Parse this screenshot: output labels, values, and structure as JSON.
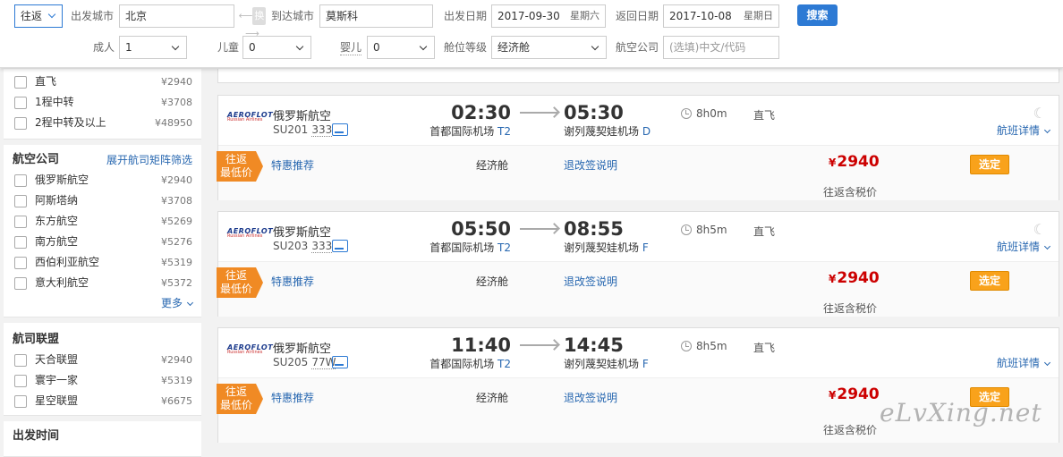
{
  "search": {
    "trip_type": "往返",
    "from_label": "出发城市",
    "from_value": "北京",
    "swap_label": "换",
    "to_label": "到达城市",
    "to_value": "莫斯科",
    "depart_label": "出发日期",
    "depart_date": "2017-09-30",
    "depart_week": "星期六",
    "return_label": "返回日期",
    "return_date": "2017-10-08",
    "return_week": "星期日",
    "search_button": "搜索",
    "adult_label": "成人",
    "adult_value": "1",
    "child_label": "儿童",
    "child_value": "0",
    "infant_label": "婴儿",
    "infant_value": "0",
    "cabin_label": "舱位等级",
    "cabin_value": "经济舱",
    "airline_label": "航空公司",
    "airline_placeholder": "(选填)中文/代码"
  },
  "sidebar": {
    "stops": [
      {
        "label": "直飞",
        "price": "¥2940"
      },
      {
        "label": "1程中转",
        "price": "¥3708"
      },
      {
        "label": "2程中转及以上",
        "price": "¥48950"
      }
    ],
    "airlines_title": "航空公司",
    "airlines_link": "展开航司矩阵筛选",
    "airlines": [
      {
        "label": "俄罗斯航空",
        "price": "¥2940"
      },
      {
        "label": "阿斯塔纳",
        "price": "¥3708"
      },
      {
        "label": "东方航空",
        "price": "¥5269"
      },
      {
        "label": "南方航空",
        "price": "¥5276"
      },
      {
        "label": "西伯利亚航空",
        "price": "¥5319"
      },
      {
        "label": "意大利航空",
        "price": "¥5372"
      }
    ],
    "more_label": "更多",
    "alliance_title": "航司联盟",
    "alliances": [
      {
        "label": "天合联盟",
        "price": "¥2940"
      },
      {
        "label": "寰宇一家",
        "price": "¥5319"
      },
      {
        "label": "星空联盟",
        "price": "¥6675"
      }
    ],
    "depart_time_title": "出发时间"
  },
  "flights": [
    {
      "logo_text": "AEROFLOT",
      "logo_sub": "Russian Airlines",
      "airline": "俄罗斯航空",
      "flight_no": "SU201",
      "plane": "333",
      "dep_time": "02:30",
      "dep_airport": "首都国际机场",
      "dep_terminal": "T2",
      "arr_time": "05:30",
      "arr_airport": "谢列蔑契娃机场",
      "arr_terminal": "D",
      "duration": "8h0m",
      "stop_type": "直飞",
      "night": true,
      "detail": "航班详情",
      "tag": "往返最低价",
      "special": "特惠推荐",
      "cabin": "经济舱",
      "rule": "退改签说明",
      "currency": "¥",
      "price": "2940",
      "select": "选定",
      "tax_note": "往返含税价"
    },
    {
      "logo_text": "AEROFLOT",
      "logo_sub": "Russian Airlines",
      "airline": "俄罗斯航空",
      "flight_no": "SU203",
      "plane": "333",
      "dep_time": "05:50",
      "dep_airport": "首都国际机场",
      "dep_terminal": "T2",
      "arr_time": "08:55",
      "arr_airport": "谢列蔑契娃机场",
      "arr_terminal": "F",
      "duration": "8h5m",
      "stop_type": "直飞",
      "night": true,
      "detail": "航班详情",
      "tag": "往返最低价",
      "special": "特惠推荐",
      "cabin": "经济舱",
      "rule": "退改签说明",
      "currency": "¥",
      "price": "2940",
      "select": "选定",
      "tax_note": "往返含税价"
    },
    {
      "logo_text": "AEROFLOT",
      "logo_sub": "Russian Airlines",
      "airline": "俄罗斯航空",
      "flight_no": "SU205",
      "plane": "77W",
      "dep_time": "11:40",
      "dep_airport": "首都国际机场",
      "dep_terminal": "T2",
      "arr_time": "14:45",
      "arr_airport": "谢列蔑契娃机场",
      "arr_terminal": "F",
      "duration": "8h5m",
      "stop_type": "直飞",
      "night": false,
      "detail": "航班详情",
      "tag": "往返最低价",
      "special": "特惠推荐",
      "cabin": "经济舱",
      "rule": "退改签说明",
      "currency": "¥",
      "price": "2940",
      "select": "选定",
      "tax_note": "往返含税价"
    }
  ],
  "watermark": "eLvXing.net"
}
